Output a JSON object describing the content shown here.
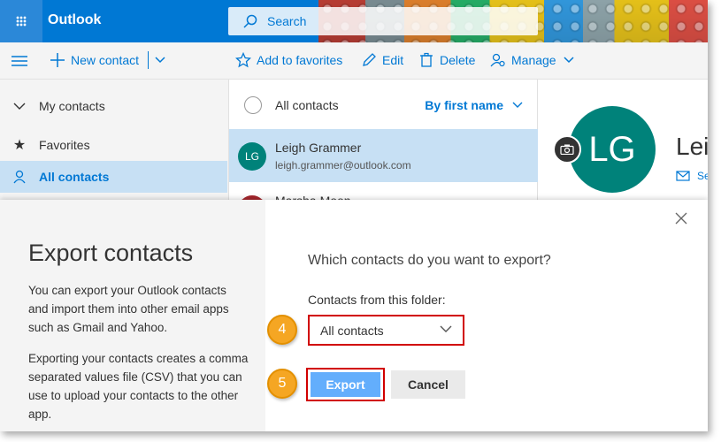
{
  "app": {
    "brand": "Outlook",
    "search_placeholder": "Search"
  },
  "commands": {
    "new_contact": "New contact",
    "add_favorites": "Add to favorites",
    "edit": "Edit",
    "delete": "Delete",
    "manage": "Manage"
  },
  "nav": {
    "my_contacts": "My contacts",
    "items": [
      {
        "label": "Favorites"
      },
      {
        "label": "All contacts"
      }
    ]
  },
  "list": {
    "header": "All contacts",
    "sort": "By first name",
    "contacts": [
      {
        "initials": "LG",
        "name": "Leigh Grammer",
        "email": "leigh.grammer@outlook.com"
      },
      {
        "name": "Marsha Moon"
      }
    ]
  },
  "detail": {
    "initials": "LG",
    "name": "Leigh Grammer",
    "send": "Send email"
  },
  "dialog": {
    "title": "Export contacts",
    "para1": "You can export your Outlook contacts and import them into other email apps such as Gmail and Yahoo.",
    "para2": "Exporting your contacts creates a comma separated values file (CSV) that you can use to upload your contacts to the other app.",
    "question": "Which contacts do you want to export?",
    "folder_label": "Contacts from this folder:",
    "folder_value": "All contacts",
    "export": "Export",
    "cancel": "Cancel",
    "step_select": "4",
    "step_export": "5"
  },
  "colors": {
    "accent": "#0078d4",
    "highlight": "#d10000",
    "step": "#f5a623",
    "avatar": "#00827a"
  }
}
